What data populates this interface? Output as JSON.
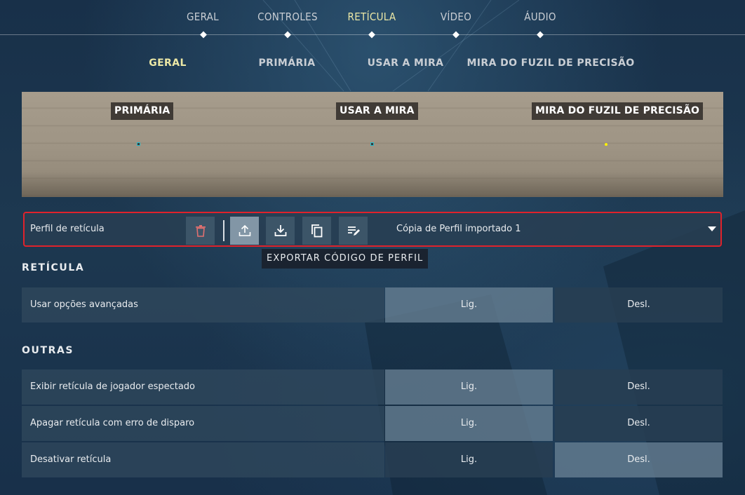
{
  "top_tabs": [
    {
      "label": "GERAL",
      "active": false
    },
    {
      "label": "CONTROLES",
      "active": false
    },
    {
      "label": "RETÍCULA",
      "active": true
    },
    {
      "label": "VÍDEO",
      "active": false
    },
    {
      "label": "ÁUDIO",
      "active": false
    }
  ],
  "sub_tabs": [
    {
      "label": "GERAL",
      "active": true
    },
    {
      "label": "PRIMÁRIA",
      "active": false
    },
    {
      "label": "USAR A MIRA",
      "active": false
    },
    {
      "label": "MIRA DO FUZIL DE PRECISÃO",
      "active": false
    }
  ],
  "preview": {
    "labels": [
      "PRIMÁRIA",
      "USAR A MIRA",
      "MIRA DO FUZIL DE PRECISÃO"
    ],
    "crosshair_colors": [
      "#2bb9c7",
      "#2bb9c7",
      "#fff300"
    ]
  },
  "profile": {
    "label": "Perfil de retícula",
    "selected": "Cópia de Perfil importado 1",
    "highlight_color": "#e0222b",
    "buttons": [
      "trash-icon",
      "upload-icon",
      "download-icon",
      "copy-icon",
      "rename-icon"
    ]
  },
  "tooltip": "EXPORTAR CÓDIGO DE PERFIL",
  "sections": {
    "reticula": {
      "title": "RETÍCULA",
      "rows": [
        {
          "label": "Usar opções avançadas",
          "on": "Lig.",
          "off": "Desl.",
          "value": "on"
        }
      ]
    },
    "outras": {
      "title": "OUTRAS",
      "rows": [
        {
          "label": "Exibir retícula de jogador espectado",
          "on": "Lig.",
          "off": "Desl.",
          "value": "on"
        },
        {
          "label": "Apagar retícula com erro de disparo",
          "on": "Lig.",
          "off": "Desl.",
          "value": "on"
        },
        {
          "label": "Desativar retícula",
          "on": "Lig.",
          "off": "Desl.",
          "value": "off"
        }
      ]
    }
  }
}
